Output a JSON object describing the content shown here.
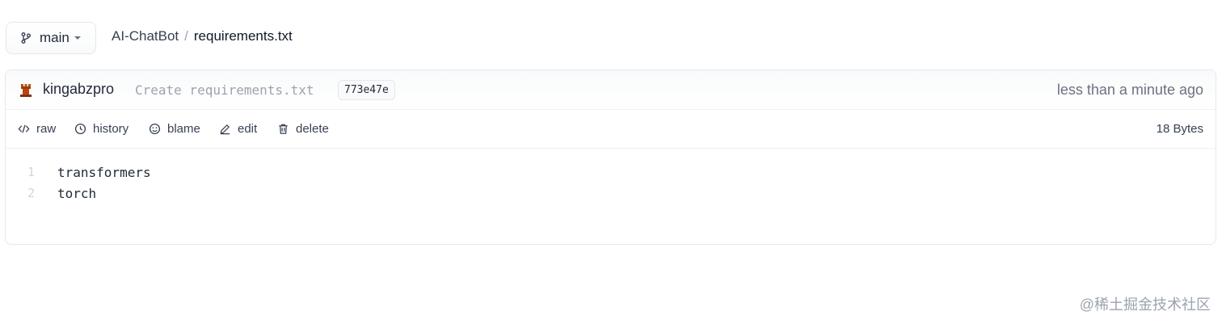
{
  "branch": {
    "label": "main",
    "icon": "git-branch-icon"
  },
  "breadcrumb": {
    "repo": "AI-ChatBot",
    "separator": "/",
    "file": "requirements.txt"
  },
  "commit": {
    "author": "kingabzpro",
    "message": "Create requirements.txt",
    "sha": "773e47e",
    "time": "less than a minute ago",
    "avatar_icon": "chess-rook-avatar-icon"
  },
  "actions": [
    {
      "label": "raw",
      "icon": "code-icon"
    },
    {
      "label": "history",
      "icon": "clock-icon"
    },
    {
      "label": "blame",
      "icon": "smile-icon"
    },
    {
      "label": "edit",
      "icon": "pencil-icon"
    },
    {
      "label": "delete",
      "icon": "trash-icon"
    }
  ],
  "file_size": "18 Bytes",
  "code_lines": [
    {
      "number": "1",
      "text": "transformers"
    },
    {
      "number": "2",
      "text": "torch"
    }
  ],
  "watermark": "@稀土掘金技术社区",
  "colors": {
    "border": "#e5e7eb",
    "muted_text": "#6b7280",
    "avatar": "#b45309"
  }
}
